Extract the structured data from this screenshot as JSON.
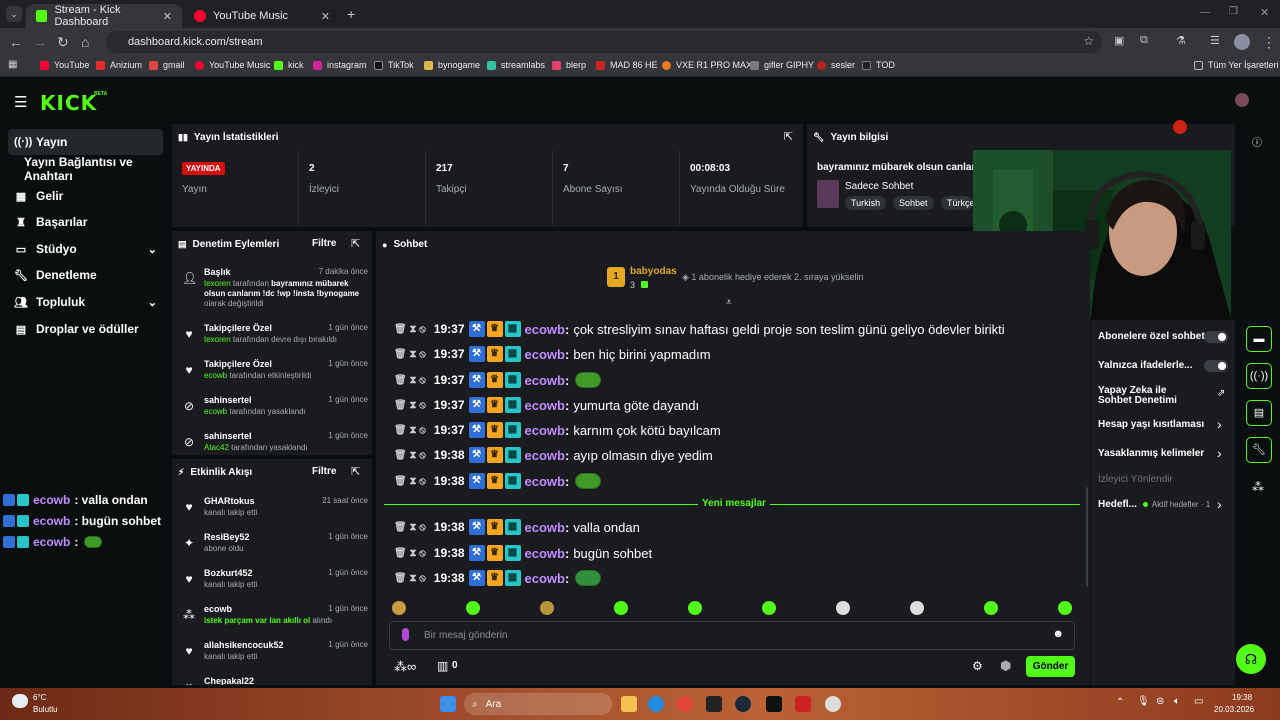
{
  "browser": {
    "tabs": [
      {
        "label": "Stream - Kick Dashboard",
        "active": true
      },
      {
        "label": "YouTube Music",
        "active": false
      }
    ],
    "url": "dashboard.kick.com/stream",
    "bookmarks": [
      "YouTube",
      "Anizium",
      "gmail",
      "YouTube Music",
      "kick",
      "instagram",
      "TikTok",
      "bynogame",
      "streamlabs",
      "blerp",
      "MAD 86 HE",
      "VXE R1 PRO MAX",
      "gifler GIPHY",
      "sesler",
      "TOD"
    ],
    "bookmarks_folder": "Tüm Yer İşaretleri"
  },
  "kick": {
    "logo": "KICK",
    "logo_sup": "BETA",
    "sidebar": [
      {
        "label": "Yayın",
        "icon": "broadcast-icon",
        "selected": true
      },
      {
        "label": "Yayın Bağlantısı ve Anahtarı",
        "icon": "",
        "selected": false
      },
      {
        "label": "Gelir",
        "icon": "money-icon",
        "selected": false
      },
      {
        "label": "Başarılar",
        "icon": "trophy-icon",
        "selected": false
      },
      {
        "label": "Stüdyo",
        "icon": "studio-icon",
        "selected": false
      },
      {
        "label": "Denetleme",
        "icon": "wrench-icon",
        "selected": false
      },
      {
        "label": "Topluluk",
        "icon": "people-icon",
        "selected": false
      },
      {
        "label": "Droplar ve ödüller",
        "icon": "gift-icon",
        "selected": false
      }
    ],
    "stats": {
      "title": "Yayın İstatistikleri",
      "items": [
        {
          "value": "YAYINDA",
          "label": "Yayın",
          "live": true
        },
        {
          "value": "2",
          "label": "İzleyici"
        },
        {
          "value": "217",
          "label": "Takipçi"
        },
        {
          "value": "7",
          "label": "Abone Sayısı"
        },
        {
          "value": "00:08:03",
          "label": "Yayında Olduğu Süre"
        }
      ]
    },
    "info": {
      "title": "Yayın bilgisi",
      "stream_title": "bayramınız mübarek olsun canlarım",
      "category": "Sadece Sohbet",
      "tags": [
        "Turkish",
        "Sohbet",
        "Türkçe"
      ]
    },
    "mod_actions": {
      "title": "Denetim Eylemleri",
      "filter": "Filtre",
      "items": [
        {
          "title": "Başlık",
          "time": "7 dakika önce",
          "line1a": "texoren",
          "line1b": " tarafından ",
          "line1c": "bayramınız mübarek olsun canlarım !dc !wp !insta !bynogame",
          "line2": "olarak değiştirildi"
        },
        {
          "title": "Takipçilere Özel",
          "time": "1 gün önce",
          "line1a": "texoren",
          "line1b": " tarafından devre dışı bırakıldı"
        },
        {
          "title": "Takipçilere Özel",
          "time": "1 gün önce",
          "line1a": "ecowb",
          "line1b": " tarafından etkinleştirildi"
        },
        {
          "title": "sahinsertel",
          "time": "1 gün önce",
          "line1a": "ecowb",
          "line1b": " tarafından yasaklandı"
        },
        {
          "title": "sahinsertel",
          "time": "1 gün önce",
          "line1a": "Atac42",
          "line1b": " tarafından yasaklandı"
        }
      ]
    },
    "activity": {
      "title": "Etkinlik Akışı",
      "filter": "Filtre",
      "items": [
        {
          "title": "GHARtokus",
          "time": "21 saat önce",
          "sub": "kanalı takip etti"
        },
        {
          "title": "ResiBey52",
          "time": "1 gün önce",
          "sub": "abone oldu"
        },
        {
          "title": "Bozkurt452",
          "time": "1 gün önce",
          "sub": "kanalı takip etti"
        },
        {
          "title": "ecowb",
          "time": "1 gün önce",
          "sub_green": "istek parçam var lan akıllı ol",
          "sub": " alındı"
        },
        {
          "title": "allahsikencocuk52",
          "time": "1 gün önce",
          "sub": "kanalı takip etti"
        },
        {
          "title": "Chepakal22",
          "time": "",
          "sub": ""
        }
      ]
    },
    "chat": {
      "title": "Sohbet",
      "pinned_user": "babyodas",
      "pinned_rank": "1",
      "pinned_count": "3",
      "pinned_text": "1 abonelik hediye ederek 2. sıraya yükselin",
      "new_messages": "Yeni mesajlar",
      "messages": [
        {
          "time": "19:37",
          "user": "ecowb",
          "text": "çok stresliyim sınav haftası geldi proje son teslim günü geliyo ödevler birikti",
          "emote": false
        },
        {
          "time": "19:37",
          "user": "ecowb",
          "text": "ben hiç birini yapmadım",
          "emote": false
        },
        {
          "time": "19:37",
          "user": "ecowb",
          "text": "",
          "emote": true
        },
        {
          "time": "19:37",
          "user": "ecowb",
          "text": "yumurta göte dayandı",
          "emote": false
        },
        {
          "time": "19:37",
          "user": "ecowb",
          "text": "karnım çok kötü bayılcam",
          "emote": false
        },
        {
          "time": "19:38",
          "user": "ecowb",
          "text": "ayıp olmasın diye yedim",
          "emote": false
        },
        {
          "time": "19:38",
          "user": "ecowb",
          "text": "",
          "emote": true
        },
        {
          "time": "19:38",
          "user": "ecowb",
          "text": "valla ondan",
          "emote": false
        },
        {
          "time": "19:38",
          "user": "ecowb",
          "text": "bugün sohbet",
          "emote": false
        },
        {
          "time": "19:38",
          "user": "ecowb",
          "text": "",
          "emote": true
        }
      ],
      "input_placeholder": "Bir mesaj gönderin",
      "points": "0",
      "send": "Gönder"
    },
    "overlay_chat": [
      {
        "user": "ecowb",
        "text": ": valla ondan"
      },
      {
        "user": "ecowb",
        "text": ": bugün sohbet"
      },
      {
        "user": "ecowb",
        "text": ":"
      }
    ],
    "chat_settings": [
      {
        "label": "Abonelere özel sohbet",
        "type": "toggle"
      },
      {
        "label": "Yalnızca ifadelerle...",
        "type": "toggle"
      },
      {
        "label": "Yapay Zeka ile Sohbet Denetimi",
        "type": "link"
      },
      {
        "label": "Hesap yaşı kısıtlaması",
        "type": "chevron"
      },
      {
        "label": "Yasaklanmış kelimeler",
        "type": "chevron"
      },
      {
        "label": "İzleyici Yönlendir",
        "type": "disabled"
      },
      {
        "label": "Hedefl...",
        "type": "chevron",
        "extra": "Aktif hedefler · 1"
      }
    ]
  },
  "taskbar": {
    "weather_temp": "6°C",
    "weather_desc": "Bulutlu",
    "search": "Ara",
    "time": "19:38",
    "date": "20.03.2026"
  },
  "colors": {
    "accent": "#53fc18",
    "panel": "#191b1f",
    "bg": "#0b0e0f",
    "username": "#c08cff"
  }
}
